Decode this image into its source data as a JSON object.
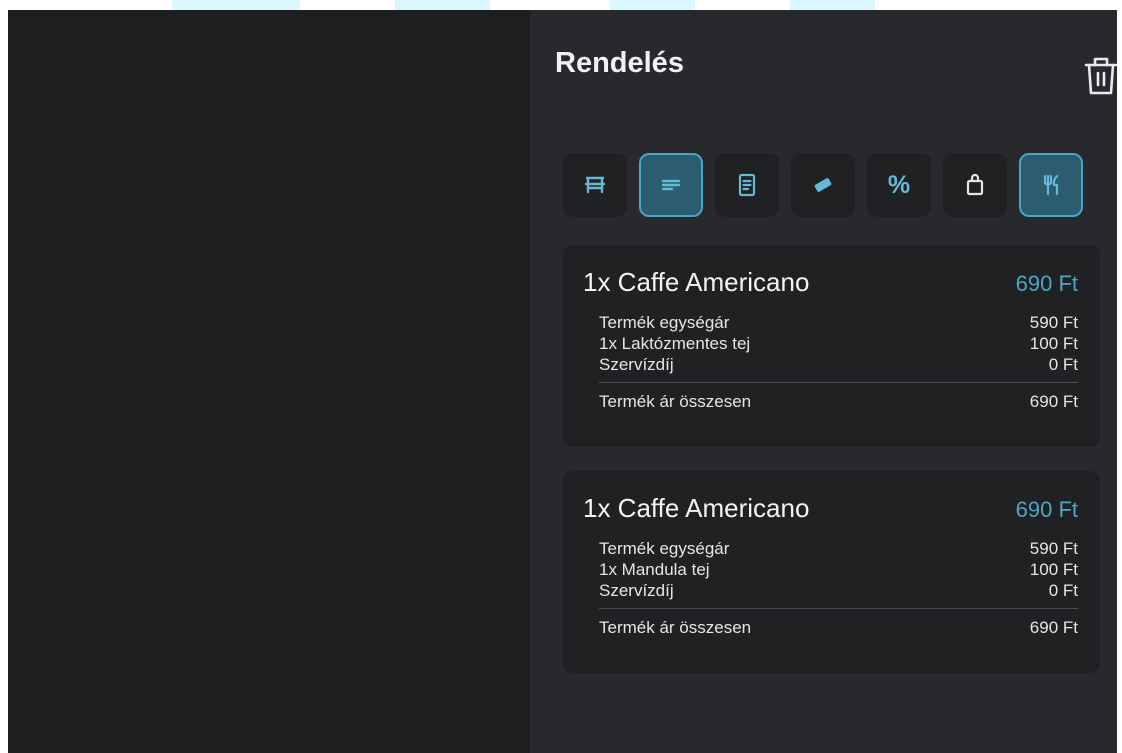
{
  "order": {
    "title": "Rendelés",
    "tabs": [
      {
        "icon": "table-icon",
        "active": false
      },
      {
        "icon": "lines-icon",
        "active": true
      },
      {
        "icon": "receipt-icon",
        "active": false
      },
      {
        "icon": "card-icon",
        "active": false
      },
      {
        "icon": "percent-icon",
        "active": false,
        "glyph": "%"
      },
      {
        "icon": "bag-icon",
        "active": false
      },
      {
        "icon": "cutlery-icon",
        "active": true
      }
    ],
    "items": [
      {
        "name": "1x Caffe Americano",
        "price": "690 Ft",
        "unit_label": "Termék egységár",
        "unit_value": "590 Ft",
        "extra_label": "1x Laktózmentes tej",
        "extra_value": "100 Ft",
        "service_label": "Szervízdíj",
        "service_value": "0 Ft",
        "total_label": "Termék ár összesen",
        "total_value": "690 Ft"
      },
      {
        "name": "1x Caffe Americano",
        "price": "690 Ft",
        "unit_label": "Termék egységár",
        "unit_value": "590 Ft",
        "extra_label": "1x Mandula tej",
        "extra_value": "100 Ft",
        "service_label": "Szervízdíj",
        "service_value": "0 Ft",
        "total_label": "Termék ár összesen",
        "total_value": "690 Ft"
      }
    ]
  },
  "colors": {
    "accent": "#4fa5c4",
    "panel": "#27292c",
    "card": "#1f2123",
    "left_pane": "#1d1e20"
  }
}
